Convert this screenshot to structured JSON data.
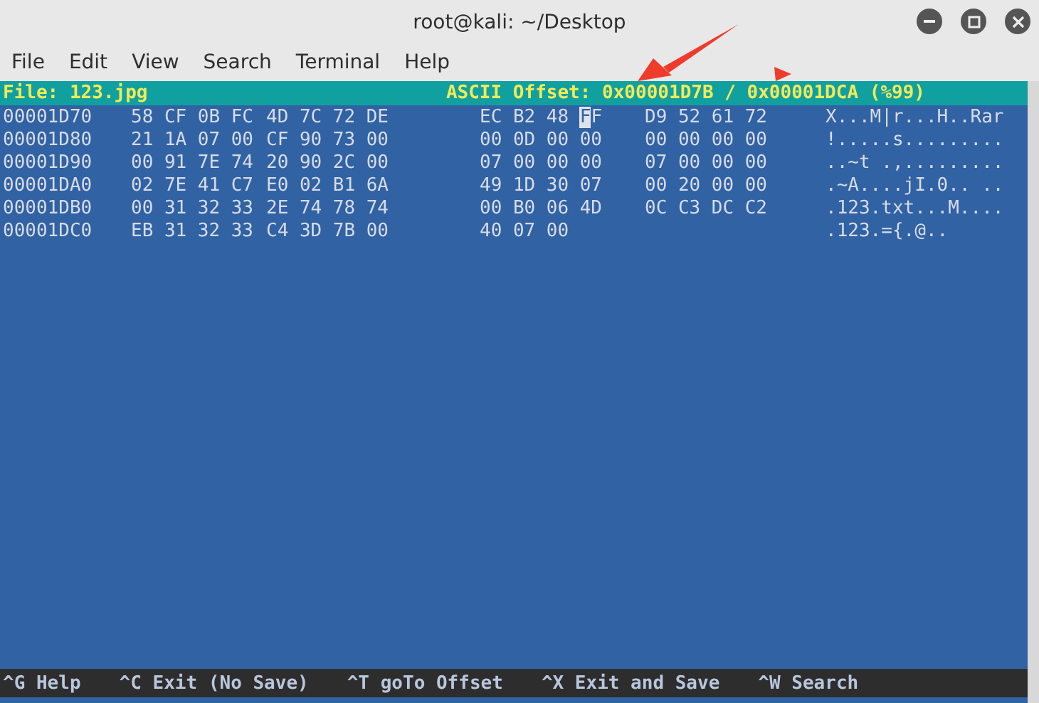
{
  "window": {
    "title": "root@kali: ~/Desktop"
  },
  "menu": [
    "File",
    "Edit",
    "View",
    "Search",
    "Terminal",
    "Help"
  ],
  "header": {
    "file": "File: 123.jpg",
    "offset": "ASCII Offset: 0x00001D7B / 0x00001DCA (%99)"
  },
  "rows": [
    {
      "address": "00001D70",
      "bytes": [
        {
          "text": "58",
          "cursor": false
        },
        {
          "text": "CF",
          "cursor": false
        },
        {
          "text": "0B",
          "cursor": false
        },
        {
          "text": "FC",
          "cursor": false
        },
        {
          "text": "4D",
          "cursor": false
        },
        {
          "text": "7C",
          "cursor": false
        },
        {
          "text": "72",
          "cursor": false
        },
        {
          "text": "DE",
          "cursor": false
        },
        {
          "text": "EC",
          "cursor": false
        },
        {
          "text": "B2",
          "cursor": false
        },
        {
          "text": "48",
          "cursor": false
        },
        {
          "text": "FF",
          "cursor": true
        },
        {
          "text": "D9",
          "cursor": false
        },
        {
          "text": "52",
          "cursor": false
        },
        {
          "text": "61",
          "cursor": false
        },
        {
          "text": "72",
          "cursor": false
        }
      ],
      "ascii": "X...M|r...H..Rar"
    },
    {
      "address": "00001D80",
      "bytes": [
        {
          "text": "21",
          "cursor": false
        },
        {
          "text": "1A",
          "cursor": false
        },
        {
          "text": "07",
          "cursor": false
        },
        {
          "text": "00",
          "cursor": false
        },
        {
          "text": "CF",
          "cursor": false
        },
        {
          "text": "90",
          "cursor": false
        },
        {
          "text": "73",
          "cursor": false
        },
        {
          "text": "00",
          "cursor": false
        },
        {
          "text": "00",
          "cursor": false
        },
        {
          "text": "0D",
          "cursor": false
        },
        {
          "text": "00",
          "cursor": false
        },
        {
          "text": "00",
          "cursor": false
        },
        {
          "text": "00",
          "cursor": false
        },
        {
          "text": "00",
          "cursor": false
        },
        {
          "text": "00",
          "cursor": false
        },
        {
          "text": "00",
          "cursor": false
        }
      ],
      "ascii": "!.....s........."
    },
    {
      "address": "00001D90",
      "bytes": [
        {
          "text": "00",
          "cursor": false
        },
        {
          "text": "91",
          "cursor": false
        },
        {
          "text": "7E",
          "cursor": false
        },
        {
          "text": "74",
          "cursor": false
        },
        {
          "text": "20",
          "cursor": false
        },
        {
          "text": "90",
          "cursor": false
        },
        {
          "text": "2C",
          "cursor": false
        },
        {
          "text": "00",
          "cursor": false
        },
        {
          "text": "07",
          "cursor": false
        },
        {
          "text": "00",
          "cursor": false
        },
        {
          "text": "00",
          "cursor": false
        },
        {
          "text": "00",
          "cursor": false
        },
        {
          "text": "07",
          "cursor": false
        },
        {
          "text": "00",
          "cursor": false
        },
        {
          "text": "00",
          "cursor": false
        },
        {
          "text": "00",
          "cursor": false
        }
      ],
      "ascii": "..~t .,........."
    },
    {
      "address": "00001DA0",
      "bytes": [
        {
          "text": "02",
          "cursor": false
        },
        {
          "text": "7E",
          "cursor": false
        },
        {
          "text": "41",
          "cursor": false
        },
        {
          "text": "C7",
          "cursor": false
        },
        {
          "text": "E0",
          "cursor": false
        },
        {
          "text": "02",
          "cursor": false
        },
        {
          "text": "B1",
          "cursor": false
        },
        {
          "text": "6A",
          "cursor": false
        },
        {
          "text": "49",
          "cursor": false
        },
        {
          "text": "1D",
          "cursor": false
        },
        {
          "text": "30",
          "cursor": false
        },
        {
          "text": "07",
          "cursor": false
        },
        {
          "text": "00",
          "cursor": false
        },
        {
          "text": "20",
          "cursor": false
        },
        {
          "text": "00",
          "cursor": false
        },
        {
          "text": "00",
          "cursor": false
        }
      ],
      "ascii": ".~A....jI.0.. .."
    },
    {
      "address": "00001DB0",
      "bytes": [
        {
          "text": "00",
          "cursor": false
        },
        {
          "text": "31",
          "cursor": false
        },
        {
          "text": "32",
          "cursor": false
        },
        {
          "text": "33",
          "cursor": false
        },
        {
          "text": "2E",
          "cursor": false
        },
        {
          "text": "74",
          "cursor": false
        },
        {
          "text": "78",
          "cursor": false
        },
        {
          "text": "74",
          "cursor": false
        },
        {
          "text": "00",
          "cursor": false
        },
        {
          "text": "B0",
          "cursor": false
        },
        {
          "text": "06",
          "cursor": false
        },
        {
          "text": "4D",
          "cursor": false
        },
        {
          "text": "0C",
          "cursor": false
        },
        {
          "text": "C3",
          "cursor": false
        },
        {
          "text": "DC",
          "cursor": false
        },
        {
          "text": "C2",
          "cursor": false
        }
      ],
      "ascii": ".123.txt...M...."
    },
    {
      "address": "00001DC0",
      "bytes": [
        {
          "text": "EB",
          "cursor": false
        },
        {
          "text": "31",
          "cursor": false
        },
        {
          "text": "32",
          "cursor": false
        },
        {
          "text": "33",
          "cursor": false
        },
        {
          "text": "C4",
          "cursor": false
        },
        {
          "text": "3D",
          "cursor": false
        },
        {
          "text": "7B",
          "cursor": false
        },
        {
          "text": "00",
          "cursor": false
        },
        {
          "text": "40",
          "cursor": false
        },
        {
          "text": "07",
          "cursor": false
        },
        {
          "text": "00",
          "cursor": false
        }
      ],
      "ascii": ".123.={.@.."
    }
  ],
  "shortcuts": [
    "^G Help",
    "^C Exit (No Save)",
    "^T goTo Offset",
    "^X Exit and Save",
    "^W Search"
  ]
}
